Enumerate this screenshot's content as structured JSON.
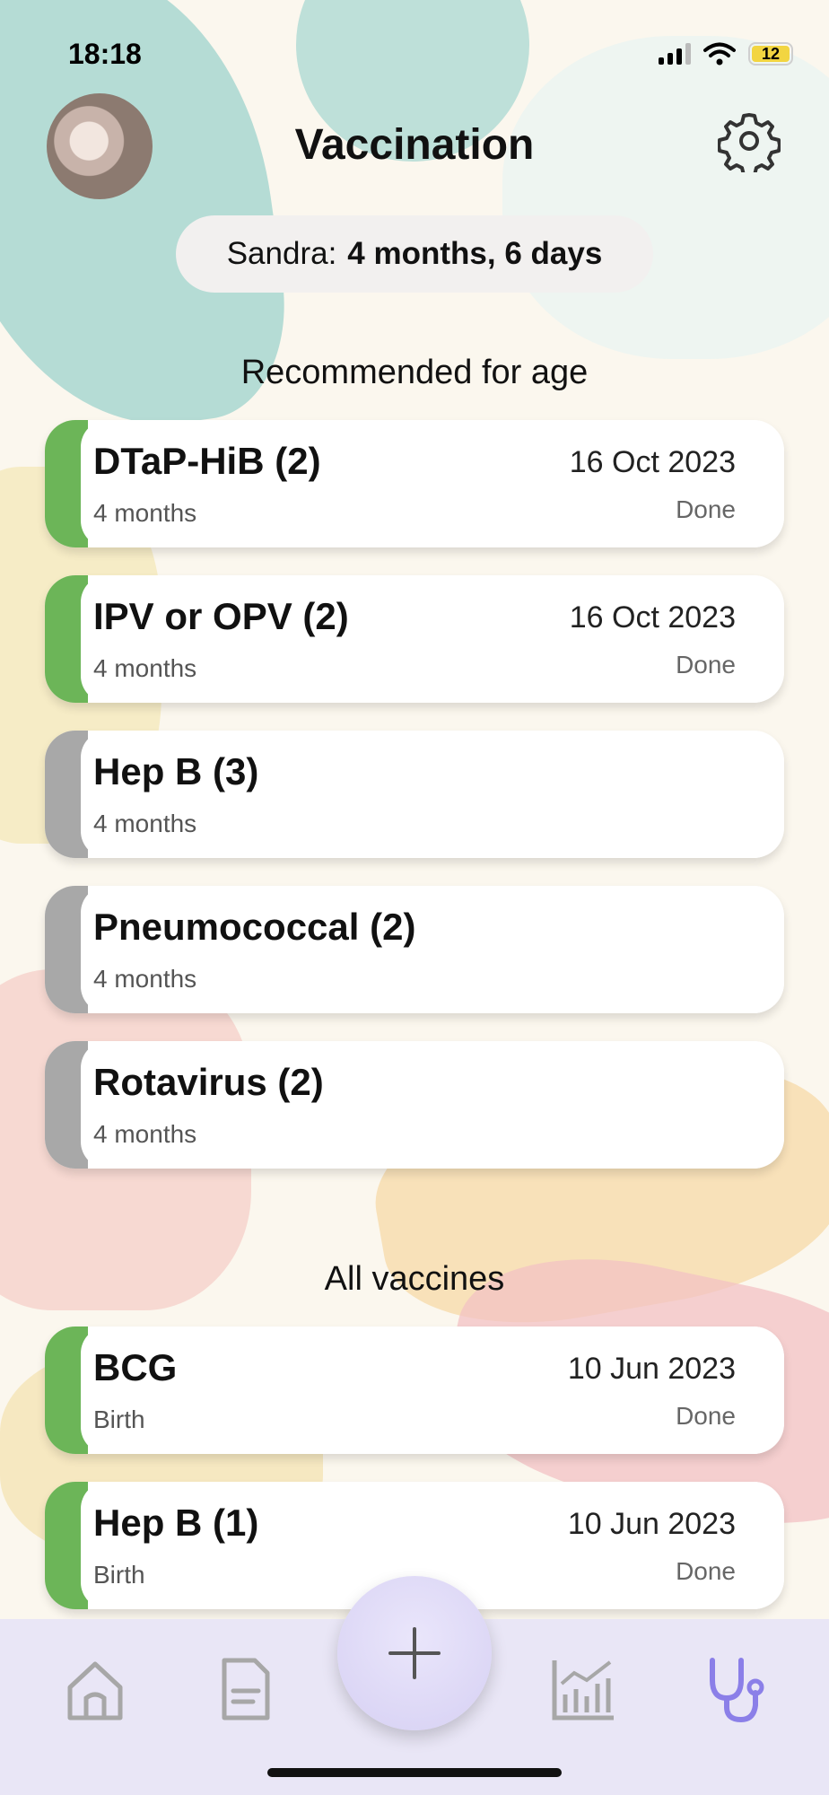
{
  "status_bar": {
    "time": "18:18",
    "battery": "12"
  },
  "header": {
    "title": "Vaccination"
  },
  "child": {
    "name": "Sandra:",
    "age": "4 months, 6 days"
  },
  "sections": {
    "recommended": "Recommended for age",
    "all": "All vaccines"
  },
  "recommended": [
    {
      "name": "DTaP-HiB (2)",
      "age": "4 months",
      "date": "16 Oct 2023",
      "status": "Done",
      "done": true
    },
    {
      "name": "IPV or OPV (2)",
      "age": "4 months",
      "date": "16 Oct 2023",
      "status": "Done",
      "done": true
    },
    {
      "name": "Hep B (3)",
      "age": "4 months",
      "date": "",
      "status": "",
      "done": false
    },
    {
      "name": "Pneumococcal (2)",
      "age": "4 months",
      "date": "",
      "status": "",
      "done": false
    },
    {
      "name": "Rotavirus (2)",
      "age": "4 months",
      "date": "",
      "status": "",
      "done": false
    }
  ],
  "all_vaccines": [
    {
      "name": "BCG",
      "age": "Birth",
      "date": "10 Jun 2023",
      "status": "Done",
      "done": true
    },
    {
      "name": "Hep B (1)",
      "age": "Birth",
      "date": "10 Jun 2023",
      "status": "Done",
      "done": true
    }
  ],
  "colors": {
    "done": "#6cb558",
    "pending": "#a8a8a8",
    "accent": "#8b7fe8",
    "nav_inactive": "#a7a7a7"
  },
  "nav": [
    "home-icon",
    "document-icon",
    "plus-icon",
    "chart-icon",
    "stethoscope-icon"
  ]
}
